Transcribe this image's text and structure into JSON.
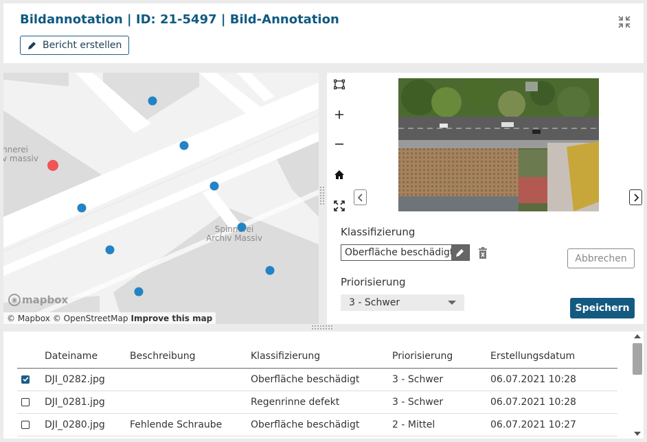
{
  "header": {
    "title": "Bildannotation | ID: 21-5497 | Bild-Annotation",
    "report_button_label": "Bericht erstellen"
  },
  "map": {
    "labels": [
      {
        "text": "nnerei\nv massiv"
      },
      {
        "text": "Spinnerei\nArchiv Massiv"
      }
    ],
    "logo_text": "mapbox",
    "attribution": {
      "mapbox": "© Mapbox",
      "osm": "© OpenStreetMap",
      "improve": "Improve this map"
    },
    "marker_colors": {
      "selected": "#f05454",
      "default": "#2383c4"
    }
  },
  "viewer": {
    "tools": [
      "select-rectangle-icon",
      "zoom-in-icon",
      "zoom-out-icon",
      "home-icon",
      "fullscreen-icon"
    ]
  },
  "annotation": {
    "classification_label": "Klassifizierung",
    "classification_value": "Oberfläche beschädigt",
    "priority_label": "Priorisierung",
    "priority_value": "3 - Schwer",
    "cancel_label": "Abbrechen",
    "save_label": "Speichern"
  },
  "table": {
    "headers": [
      "Dateiname",
      "Beschreibung",
      "Klassifizierung",
      "Priorisierung",
      "Erstellungsdatum"
    ],
    "rows": [
      {
        "checked": true,
        "file": "DJI_0282.jpg",
        "description": "",
        "classification": "Oberfläche beschädigt",
        "priority": "3 - Schwer",
        "date": "06.07.2021 10:28"
      },
      {
        "checked": false,
        "file": "DJI_0281.jpg",
        "description": "",
        "classification": "Regenrinne defekt",
        "priority": "3 - Schwer",
        "date": "06.07.2021 10:28"
      },
      {
        "checked": false,
        "file": "DJI_0280.jpg",
        "description": "Fehlende Schraube",
        "classification": "Oberfläche beschädigt",
        "priority": "2 - Mittel",
        "date": "06.07.2021 10:27"
      }
    ]
  },
  "colors": {
    "accent": "#0f5a80",
    "button_primary": "#145a80"
  }
}
